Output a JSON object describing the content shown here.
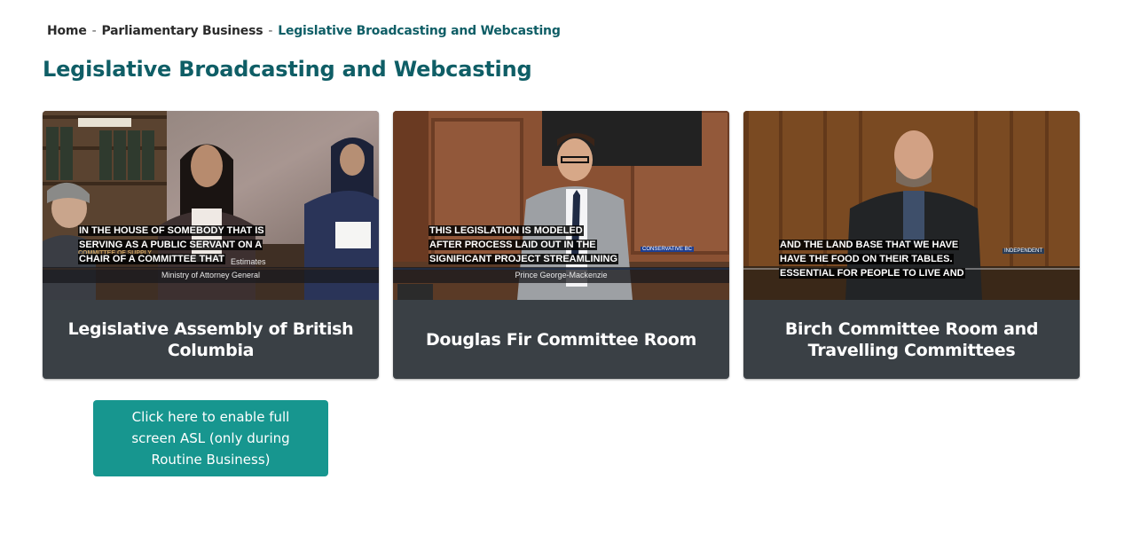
{
  "breadcrumb": {
    "home": "Home",
    "separator": "-",
    "section": "Parliamentary Business",
    "current": "Legislative Broadcasting and Webcasting"
  },
  "page": {
    "title": "Legislative Broadcasting and Webcasting"
  },
  "cards": [
    {
      "label": "Legislative Assembly of British Columbia",
      "caption": [
        "IN THE HOUSE OF SOMEBODY THAT IS",
        "SERVING AS A PUBLIC SERVANT ON A",
        "CHAIR OF A COMMITTEE THAT"
      ],
      "lower_third": "Ministry of Attorney General",
      "overlay_text": "COMMITTEE OF SUPPLY",
      "overlay_text_2": "Estimates"
    },
    {
      "label": "Douglas Fir Committee Room",
      "caption": [
        "THIS LEGISLATION IS MODELED",
        "AFTER PROCESS LAID OUT IN THE",
        "SIGNIFICANT PROJECT STREAMLINING"
      ],
      "lower_third": "Prince George-Mackenzie",
      "party_tag": "CONSERVATIVE BC"
    },
    {
      "label": "Birch Committee Room and Travelling Committees",
      "caption": [
        "AND THE LAND BASE THAT WE HAVE",
        "HAVE THE FOOD ON THEIR TABLES.",
        "ESSENTIAL FOR PEOPLE TO LIVE AND"
      ],
      "party_tag": "INDEPENDENT"
    }
  ],
  "asl_button": {
    "label": "Click here to enable full screen ASL (only during Routine Business)"
  },
  "colors": {
    "brand": "#0f5e66",
    "card_footer": "#3a4045",
    "button": "#17968f"
  }
}
